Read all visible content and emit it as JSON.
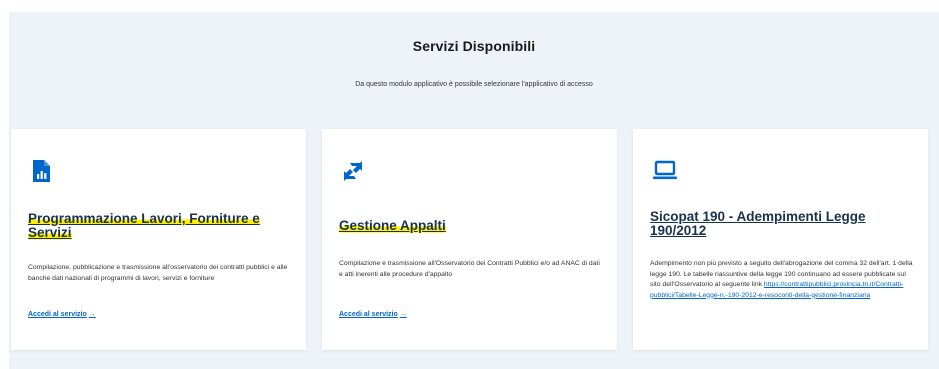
{
  "header": {
    "title": "Servizi Disponibili",
    "subtitle": "Da questo modulo applicativo è possibile selezionare l'applicativo di accesso"
  },
  "colors": {
    "section_background": "#edf3f9",
    "accent": "#0066cc",
    "title": "#17324d",
    "highlight": "#ffee00"
  },
  "cards": [
    {
      "icon": "report-chart-icon",
      "title_line1": "Programmazione Lavori, Forniture e",
      "title_line2": "Servizi",
      "description": "Compilazione, pubblicazione e trasmissione all'osservatorio dei contratti pubblici e alle banche dati nazionali di programmi di lavori, servizi e forniture",
      "link_label": "Accedi al servizio"
    },
    {
      "icon": "swap-arrows-icon",
      "title": "Gestione Appalti",
      "description": "Compilazione e trasmissione all'Osservatorio dei Contratti Pubblici e/o ad ANAC di dati e atti inerenti alle procedure d'appalto",
      "link_label": "Accedi al servizio"
    },
    {
      "icon": "laptop-icon",
      "title_line1": "Sicopat 190 - Adempimenti Legge",
      "title_line2": "190/2012",
      "description": "Adempimento non più previsto a seguito dell'abrogazione del comma 32 dell'art. 1 della legge 190. Le tabelle riassuntive della legge 190 continuano ad essere pubblicate sul sito dell'Osservatorio al seguente link",
      "description_link": "https://contrattipubblici.provincia.tn.it/Contratti-pubblici/Tabelle-Legge-n.-190-2012-e-resoconti-della-gestione-finanziaria"
    }
  ]
}
